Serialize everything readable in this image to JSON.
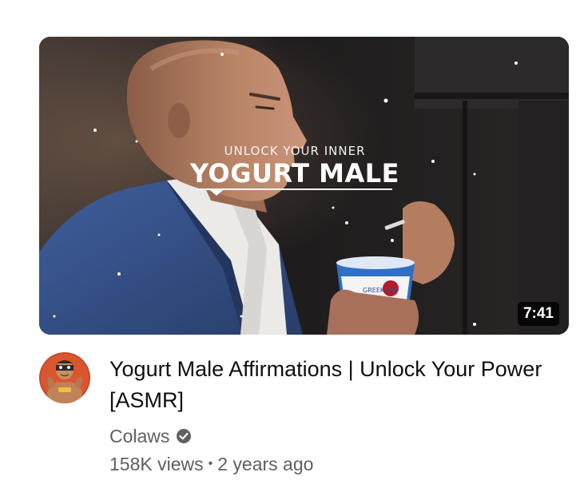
{
  "video": {
    "thumbnail": {
      "overlay_subtitle": "UNLOCK YOUR INNER",
      "overlay_title": "YOGURT MALE",
      "cup_text": "GREEK 100",
      "duration": "7:41"
    },
    "title": "Yogurt Male Affirmations | Unlock Your Power [ASMR]",
    "channel": {
      "name": "Colaws",
      "verified": true,
      "verified_icon": "check-circle-icon"
    },
    "views": "158K views",
    "separator": "•",
    "age": "2 years ago"
  },
  "colors": {
    "title": "#0f0f0f",
    "meta": "#606060",
    "duration_bg": "#000000"
  }
}
